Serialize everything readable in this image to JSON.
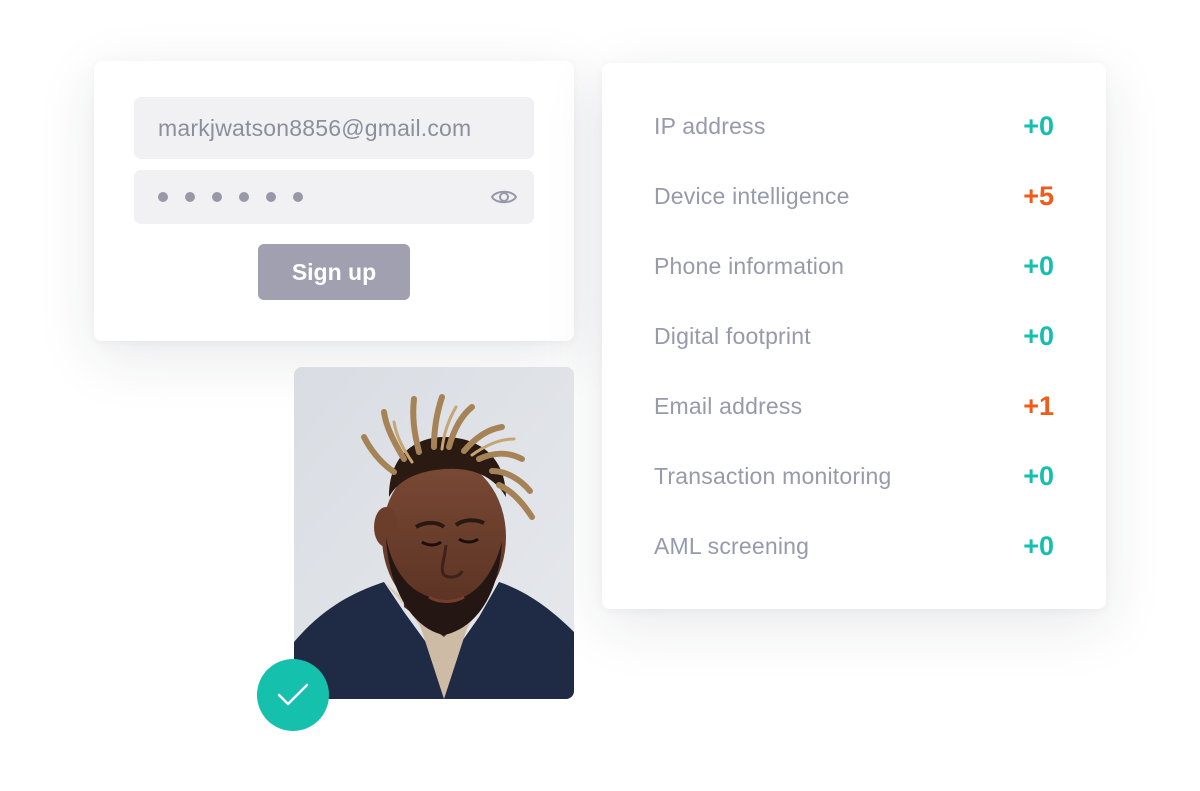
{
  "signup_form": {
    "email_value": "markjwatson8856@gmail.com",
    "password_masked_length": 6,
    "password_visibility_icon": "eye-icon",
    "submit_label": "Sign up"
  },
  "risk_checks": {
    "items": [
      {
        "label": "IP address",
        "score": "+0",
        "status": "neutral"
      },
      {
        "label": "Device intelligence",
        "score": "+5",
        "status": "risk"
      },
      {
        "label": "Phone information",
        "score": "+0",
        "status": "neutral"
      },
      {
        "label": "Digital footprint",
        "score": "+0",
        "status": "neutral"
      },
      {
        "label": "Email address",
        "score": "+1",
        "status": "risk"
      },
      {
        "label": "Transaction monitoring",
        "score": "+0",
        "status": "neutral"
      },
      {
        "label": "AML screening",
        "score": "+0",
        "status": "neutral"
      }
    ]
  },
  "verification": {
    "photo": "user-portrait",
    "badge_icon": "checkmark-icon",
    "verified": true
  },
  "colors": {
    "neutral_score": "#14bfb0",
    "risk_score": "#f25a18",
    "badge": "#15c0ad",
    "button": "#a0a0b0",
    "field_bg": "#f1f1f4"
  }
}
